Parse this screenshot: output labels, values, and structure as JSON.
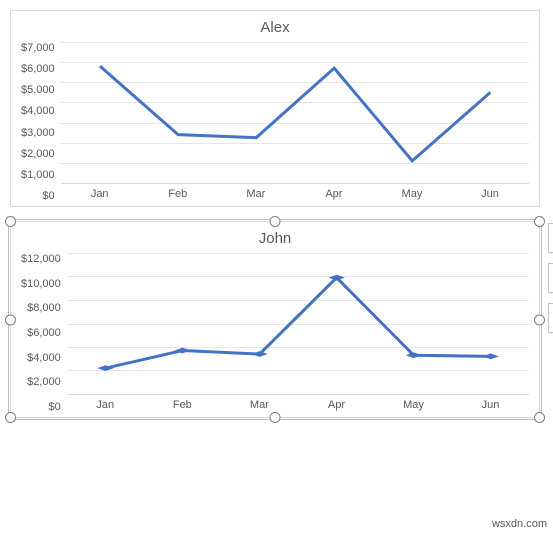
{
  "chart_data": [
    {
      "type": "line",
      "title": "Alex",
      "categories": [
        "Jan",
        "Feb",
        "Mar",
        "Apr",
        "May",
        "Jun"
      ],
      "values": [
        5800,
        2400,
        2250,
        5700,
        1100,
        4500
      ],
      "xlabel": "",
      "ylabel": "",
      "ylim": [
        0,
        7000
      ],
      "yticks": [
        "$7,000",
        "$6,000",
        "$5,000",
        "$4,000",
        "$3,000",
        "$2,000",
        "$1,000",
        "$0"
      ],
      "markers": false
    },
    {
      "type": "line",
      "title": "John",
      "categories": [
        "Jan",
        "Feb",
        "Mar",
        "Apr",
        "May",
        "Jun"
      ],
      "values": [
        2200,
        3700,
        3400,
        9900,
        3300,
        3200
      ],
      "xlabel": "",
      "ylabel": "",
      "ylim": [
        0,
        12000
      ],
      "yticks": [
        "$12,000",
        "$10,000",
        "$8,000",
        "$6,000",
        "$4,000",
        "$2,000",
        "$0"
      ],
      "markers": true
    }
  ],
  "ui": {
    "color_line": "#4472c4",
    "selected_index": 1,
    "watermark": "wsxdn.com",
    "tools": {
      "add_label": "+",
      "style_label": "brush",
      "filter_label": "filter"
    }
  }
}
